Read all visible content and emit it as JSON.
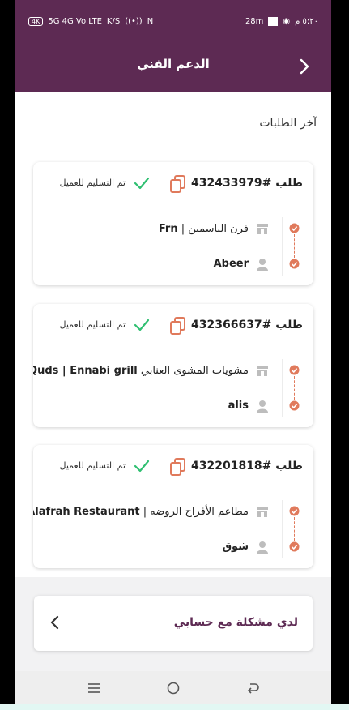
{
  "status_bar": {
    "left_badge": "4K",
    "left_signals": "5G 4G Vo LTE",
    "left_speed": "K/S",
    "right_time": "٥:٢٠ م",
    "right_net": "28m"
  },
  "header": {
    "title": "الدعم الفني",
    "back_icon": "chevron-right-icon"
  },
  "section_title": "آخر الطلبات",
  "orders": [
    {
      "order_label": "طلب #432433979",
      "status": "تم التسليم للعميل",
      "shop_arabic": "فرن الياسمين",
      "shop_latin": "Frn",
      "customer": "Abeer"
    },
    {
      "order_label": "طلب #432366637",
      "status": "تم التسليم للعميل",
      "shop_arabic": "مشويات المشوى العنابي",
      "shop_latin": "Quds | Ennabi grill",
      "customer": "alis"
    },
    {
      "order_label": "طلب #432201818",
      "status": "تم التسليم للعميل",
      "shop_arabic": "مطاعم الأفراح الروضه",
      "shop_latin": "Alafrah Restaurant",
      "customer": "شوق"
    }
  ],
  "problem_button": {
    "label": "لدي مشكلة مع حسابي",
    "icon": "chevron-left-icon"
  },
  "nav_bar": {
    "icons": [
      "menu-icon",
      "home-circle-icon",
      "back-arrow-icon"
    ]
  },
  "colors": {
    "brand": "#5d2a53",
    "accent_dot": "#e07a5c",
    "check_green": "#2fbf71"
  }
}
